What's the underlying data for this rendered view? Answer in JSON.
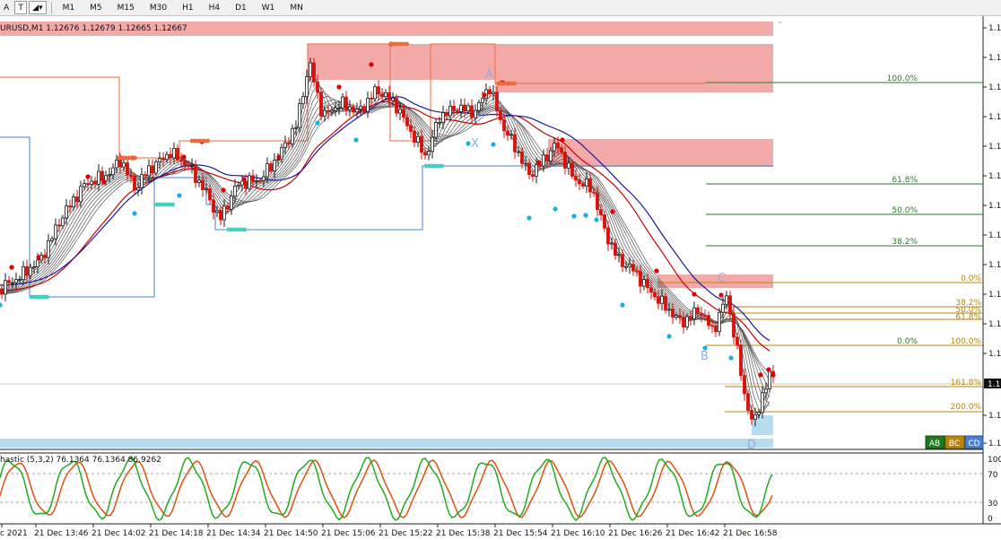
{
  "toolbar": {
    "tools": [
      "A",
      "T",
      "◢▾"
    ],
    "timeframes": [
      "M1",
      "M5",
      "M15",
      "M30",
      "H1",
      "H4",
      "D1",
      "W1",
      "MN"
    ]
  },
  "chart": {
    "symbol_header": "URUSD,M1  1.12676 1.12679 1.12665 1.12667",
    "price_label_short": "1.1",
    "current_price_tag": "1.1",
    "price_axis_labels": [
      "1.1",
      "1.1",
      "1.1",
      "1.1",
      "1.1",
      "1.1",
      "1.1",
      "1.1",
      "1.1",
      "1.1",
      "1.1",
      "1.1",
      "1.1",
      "1.1"
    ],
    "pattern_points": {
      "A": "A",
      "X": "X",
      "B": "B",
      "C": "C",
      "D": "D"
    },
    "fib_labels": {
      "f100": "100.0%",
      "f618": "61.8%",
      "f500": "50.0%",
      "f382": "38.2%",
      "f0": "0.0%",
      "g382": "38.2%",
      "g500": "50.0%",
      "g618": "61.8%",
      "g0": "0.0%",
      "g100": "100.0%",
      "g1618": "161.8%",
      "g200": "200.0%"
    },
    "pattern_buttons": [
      "AB",
      "BC",
      "CD"
    ]
  },
  "stochastic": {
    "label": "hastic (5,3,2) 76.1364 76.1364 86.9262",
    "axis_labels": [
      "100",
      "70",
      "30",
      "0"
    ]
  },
  "time_axis": [
    "c 2021",
    "21 Dec 13:46",
    "21 Dec 14:02",
    "21 Dec 14:18",
    "21 Dec 14:34",
    "21 Dec 14:50",
    "21 Dec 15:06",
    "21 Dec 15:22",
    "21 Dec 15:38",
    "21 Dec 15:54",
    "21 Dec 16:10",
    "21 Dec 16:26",
    "21 Dec 16:42",
    "21 Dec 16:58"
  ],
  "colors": {
    "bull": "#1a1a1a",
    "bear": "#d8110c",
    "zone": "#f4a9a9",
    "zone_blue": "#b8dcef",
    "ma_red": "#c80000",
    "ma_blue": "#1a1aa0",
    "stoch_main": "#22aa22",
    "stoch_signal": "#e05010",
    "fib_green": "#2a7a2a",
    "fib_orange": "#b8860b",
    "dot_red": "#e00000",
    "dot_cyan": "#1ab0e0"
  }
}
